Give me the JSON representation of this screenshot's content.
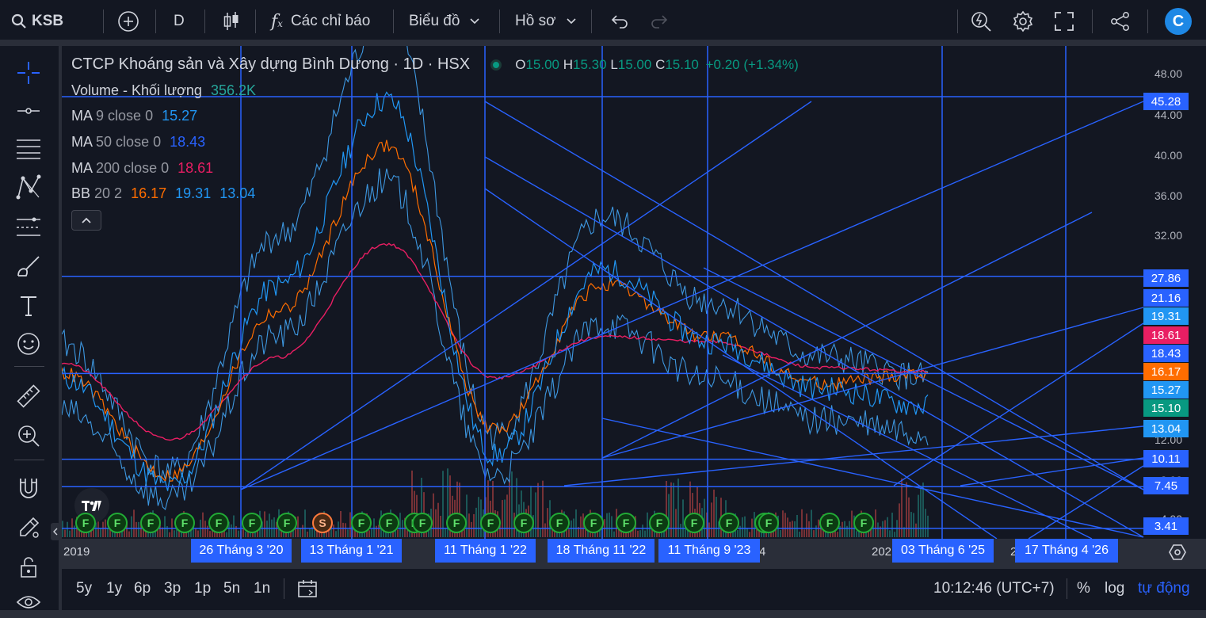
{
  "toolbar": {
    "symbol": "KSB",
    "interval": "D",
    "indicators_label": "Các chỉ báo",
    "chart_type_label": "Biểu đồ",
    "profile_label": "Hồ sơ",
    "avatar_letter": "C"
  },
  "legend": {
    "title": "CTCP Khoáng sản và Xây dựng Bình Dương · 1D · HSX",
    "o_label": "O",
    "o": "15.00",
    "h_label": "H",
    "h": "15.30",
    "l_label": "L",
    "l": "15.00",
    "c_label": "C",
    "c": "15.10",
    "change": "+0.20 (+1.34%)",
    "volume_label": "Volume - Khối lượng",
    "volume_value": "356.2K",
    "ma9_name": "MA",
    "ma9_params": "9 close 0",
    "ma9_value": "15.27",
    "ma50_name": "MA",
    "ma50_params": "50 close 0",
    "ma50_value": "18.43",
    "ma200_name": "MA",
    "ma200_params": "200 close 0",
    "ma200_value": "18.61",
    "bb_name": "BB",
    "bb_params": "20 2",
    "bb_basis": "16.17",
    "bb_upper": "19.31",
    "bb_lower": "13.04"
  },
  "price_axis": {
    "labels": [
      "48.00",
      "44.00",
      "40.00",
      "36.00",
      "32.00",
      "12.00",
      "8.00",
      "4.00"
    ],
    "badges": [
      {
        "value": "45.28",
        "color": "#2962ff"
      },
      {
        "value": "27.86",
        "color": "#2962ff"
      },
      {
        "value": "21.16",
        "color": "#2962ff"
      },
      {
        "value": "19.31",
        "color": "#2196f3"
      },
      {
        "value": "18.61",
        "color": "#e91e63"
      },
      {
        "value": "18.43",
        "color": "#2962ff"
      },
      {
        "value": "16.17",
        "color": "#ff6d00"
      },
      {
        "value": "15.27",
        "color": "#2196f3"
      },
      {
        "value": "15.10",
        "color": "#089981"
      },
      {
        "value": "13.04",
        "color": "#2196f3"
      },
      {
        "value": "10.11",
        "color": "#2962ff"
      },
      {
        "value": "7.45",
        "color": "#2962ff"
      },
      {
        "value": "3.41",
        "color": "#2962ff"
      }
    ]
  },
  "time_axis": {
    "labels": [
      "2019",
      "4",
      "202",
      "2"
    ],
    "badges": [
      "26 Tháng 3 '20",
      "13 Tháng 1 '21",
      "11 Tháng 1 '22",
      "18 Tháng 11 '22",
      "11 Tháng 9 '23",
      "03 Tháng 6 '25",
      "17 Tháng 4 '26"
    ]
  },
  "events": [
    "F",
    "F",
    "F",
    "F",
    "F",
    "F",
    "F",
    "S",
    "F",
    "F",
    "F",
    "F",
    "F",
    "F",
    "F",
    "F",
    "F",
    "F",
    "F",
    "F",
    "F",
    "F",
    "F",
    "F",
    "F"
  ],
  "bottom": {
    "ranges": [
      "5y",
      "1y",
      "6p",
      "3p",
      "1p",
      "5n",
      "1n"
    ],
    "time": "10:12:46 (UTC+7)",
    "pct": "%",
    "log": "log",
    "auto": "tự động"
  },
  "colors": {
    "background": "#131722",
    "drawing": "#2962ff",
    "ma9": "#2196f3",
    "ma50": "#ff6d00",
    "ma200": "#e91e63",
    "bb_bands": "#42a5f5",
    "up": "#26a69a",
    "down": "#ef5350"
  },
  "chart_data": {
    "type": "line",
    "symbol": "KSB",
    "title": "CTCP Khoáng sản và Xây dựng Bình Dương · 1D · HSX",
    "x": [
      "2019",
      "Mar 2020",
      "Jan 2021",
      "Jan 2022",
      "Nov 2022",
      "Sep 2023",
      "2024",
      "2025",
      "Jun 2025"
    ],
    "series": [
      {
        "name": "MA 9 close 0",
        "values": [
          18.0,
          7.5,
          27.0,
          45.0,
          10.5,
          28.5,
          21.5,
          17.0,
          15.27
        ]
      },
      {
        "name": "MA 50 close 0",
        "values": [
          18.5,
          8.5,
          24.5,
          40.5,
          13.0,
          27.0,
          22.0,
          17.5,
          18.43
        ]
      },
      {
        "name": "MA 200 close 0",
        "values": [
          19.5,
          12.0,
          20.0,
          31.0,
          18.0,
          22.0,
          21.5,
          19.0,
          18.61
        ]
      }
    ],
    "ohlc_last": {
      "open": 15.0,
      "high": 15.3,
      "low": 15.0,
      "close": 15.1
    },
    "volume_last": "356.2K",
    "bollinger": {
      "basis": 16.17,
      "upper": 19.31,
      "lower": 13.04
    },
    "horizontal_levels": [
      45.28,
      27.86,
      18.43,
      10.11,
      7.45,
      3.41
    ],
    "ylim": [
      2.4,
      50.2
    ],
    "ytick_labels": [
      "48.00",
      "44.00",
      "40.00",
      "36.00",
      "32.00",
      "12.00",
      "8.00",
      "4.00"
    ],
    "grid": false,
    "legend": "top-left"
  }
}
